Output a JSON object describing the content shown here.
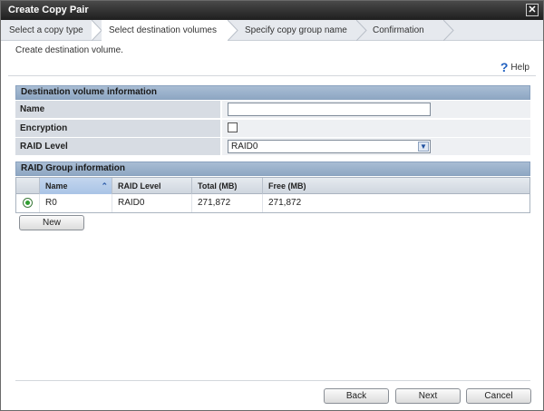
{
  "window": {
    "title": "Create Copy Pair",
    "close_glyph": "✕"
  },
  "steps": [
    {
      "label": "Select a copy type",
      "active": false
    },
    {
      "label": "Select destination volumes",
      "active": true
    },
    {
      "label": "Specify copy group name",
      "active": false
    },
    {
      "label": "Confirmation",
      "active": false
    }
  ],
  "page": {
    "subtitle": "Create destination volume.",
    "help_label": "Help",
    "help_icon": "question-icon"
  },
  "dest_section": {
    "title": "Destination volume information",
    "name_label": "Name",
    "name_value": "",
    "encryption_label": "Encryption",
    "encryption_checked": false,
    "raid_level_label": "RAID Level",
    "raid_level_value": "RAID0"
  },
  "raid_group_section": {
    "title": "RAID Group information",
    "columns": [
      "Name",
      "RAID Level",
      "Total (MB)",
      "Free (MB)"
    ],
    "sorted_column": "Name",
    "rows": [
      {
        "selected": true,
        "name": "R0",
        "raid_level": "RAID0",
        "total": "271,872",
        "free": "271,872"
      }
    ],
    "new_button": "New"
  },
  "footer": {
    "back": "Back",
    "next": "Next",
    "cancel": "Cancel"
  },
  "colors": {
    "titlebar": "#2a2a2a",
    "section_header": "#98aecb",
    "label_bg": "#d7dce3",
    "accent_green": "#2f9e2f"
  }
}
